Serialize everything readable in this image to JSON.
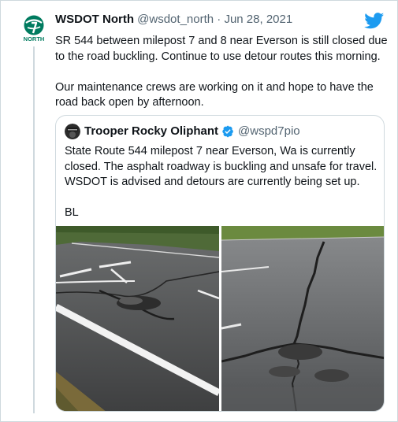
{
  "tweet": {
    "display_name": "WSDOT North",
    "handle": "@wsdot_north",
    "separator": "·",
    "date": "Jun 28, 2021",
    "avatar_label": "NORTH",
    "paragraphs": [
      "SR 544 between milepost 7 and 8 near Everson is still closed due to the road buckling. Continue to use detour routes this morning.",
      "Our maintenance crews are working on it and hope to have the road back open by afternoon."
    ]
  },
  "quoted_tweet": {
    "display_name": "Trooper Rocky Oliphant",
    "handle": "@wspd7pio",
    "paragraphs": [
      "State Route 544 milepost 7 near Everson, Wa is currently closed. The asphalt roadway is buckling and unsafe for travel. WSDOT is advised and detours are currently being set up.",
      "BL"
    ],
    "photos": [
      "buckled-road-photo-left",
      "cracked-road-photo-right"
    ]
  },
  "icons": {
    "brand": "twitter-bird-icon",
    "verified": "verified-badge-icon"
  },
  "colors": {
    "twitter_blue": "#1d9bf0",
    "wsdot_green": "#007b5f",
    "text_primary": "#0f1419",
    "text_secondary": "#536471",
    "border": "#cfd9de"
  }
}
